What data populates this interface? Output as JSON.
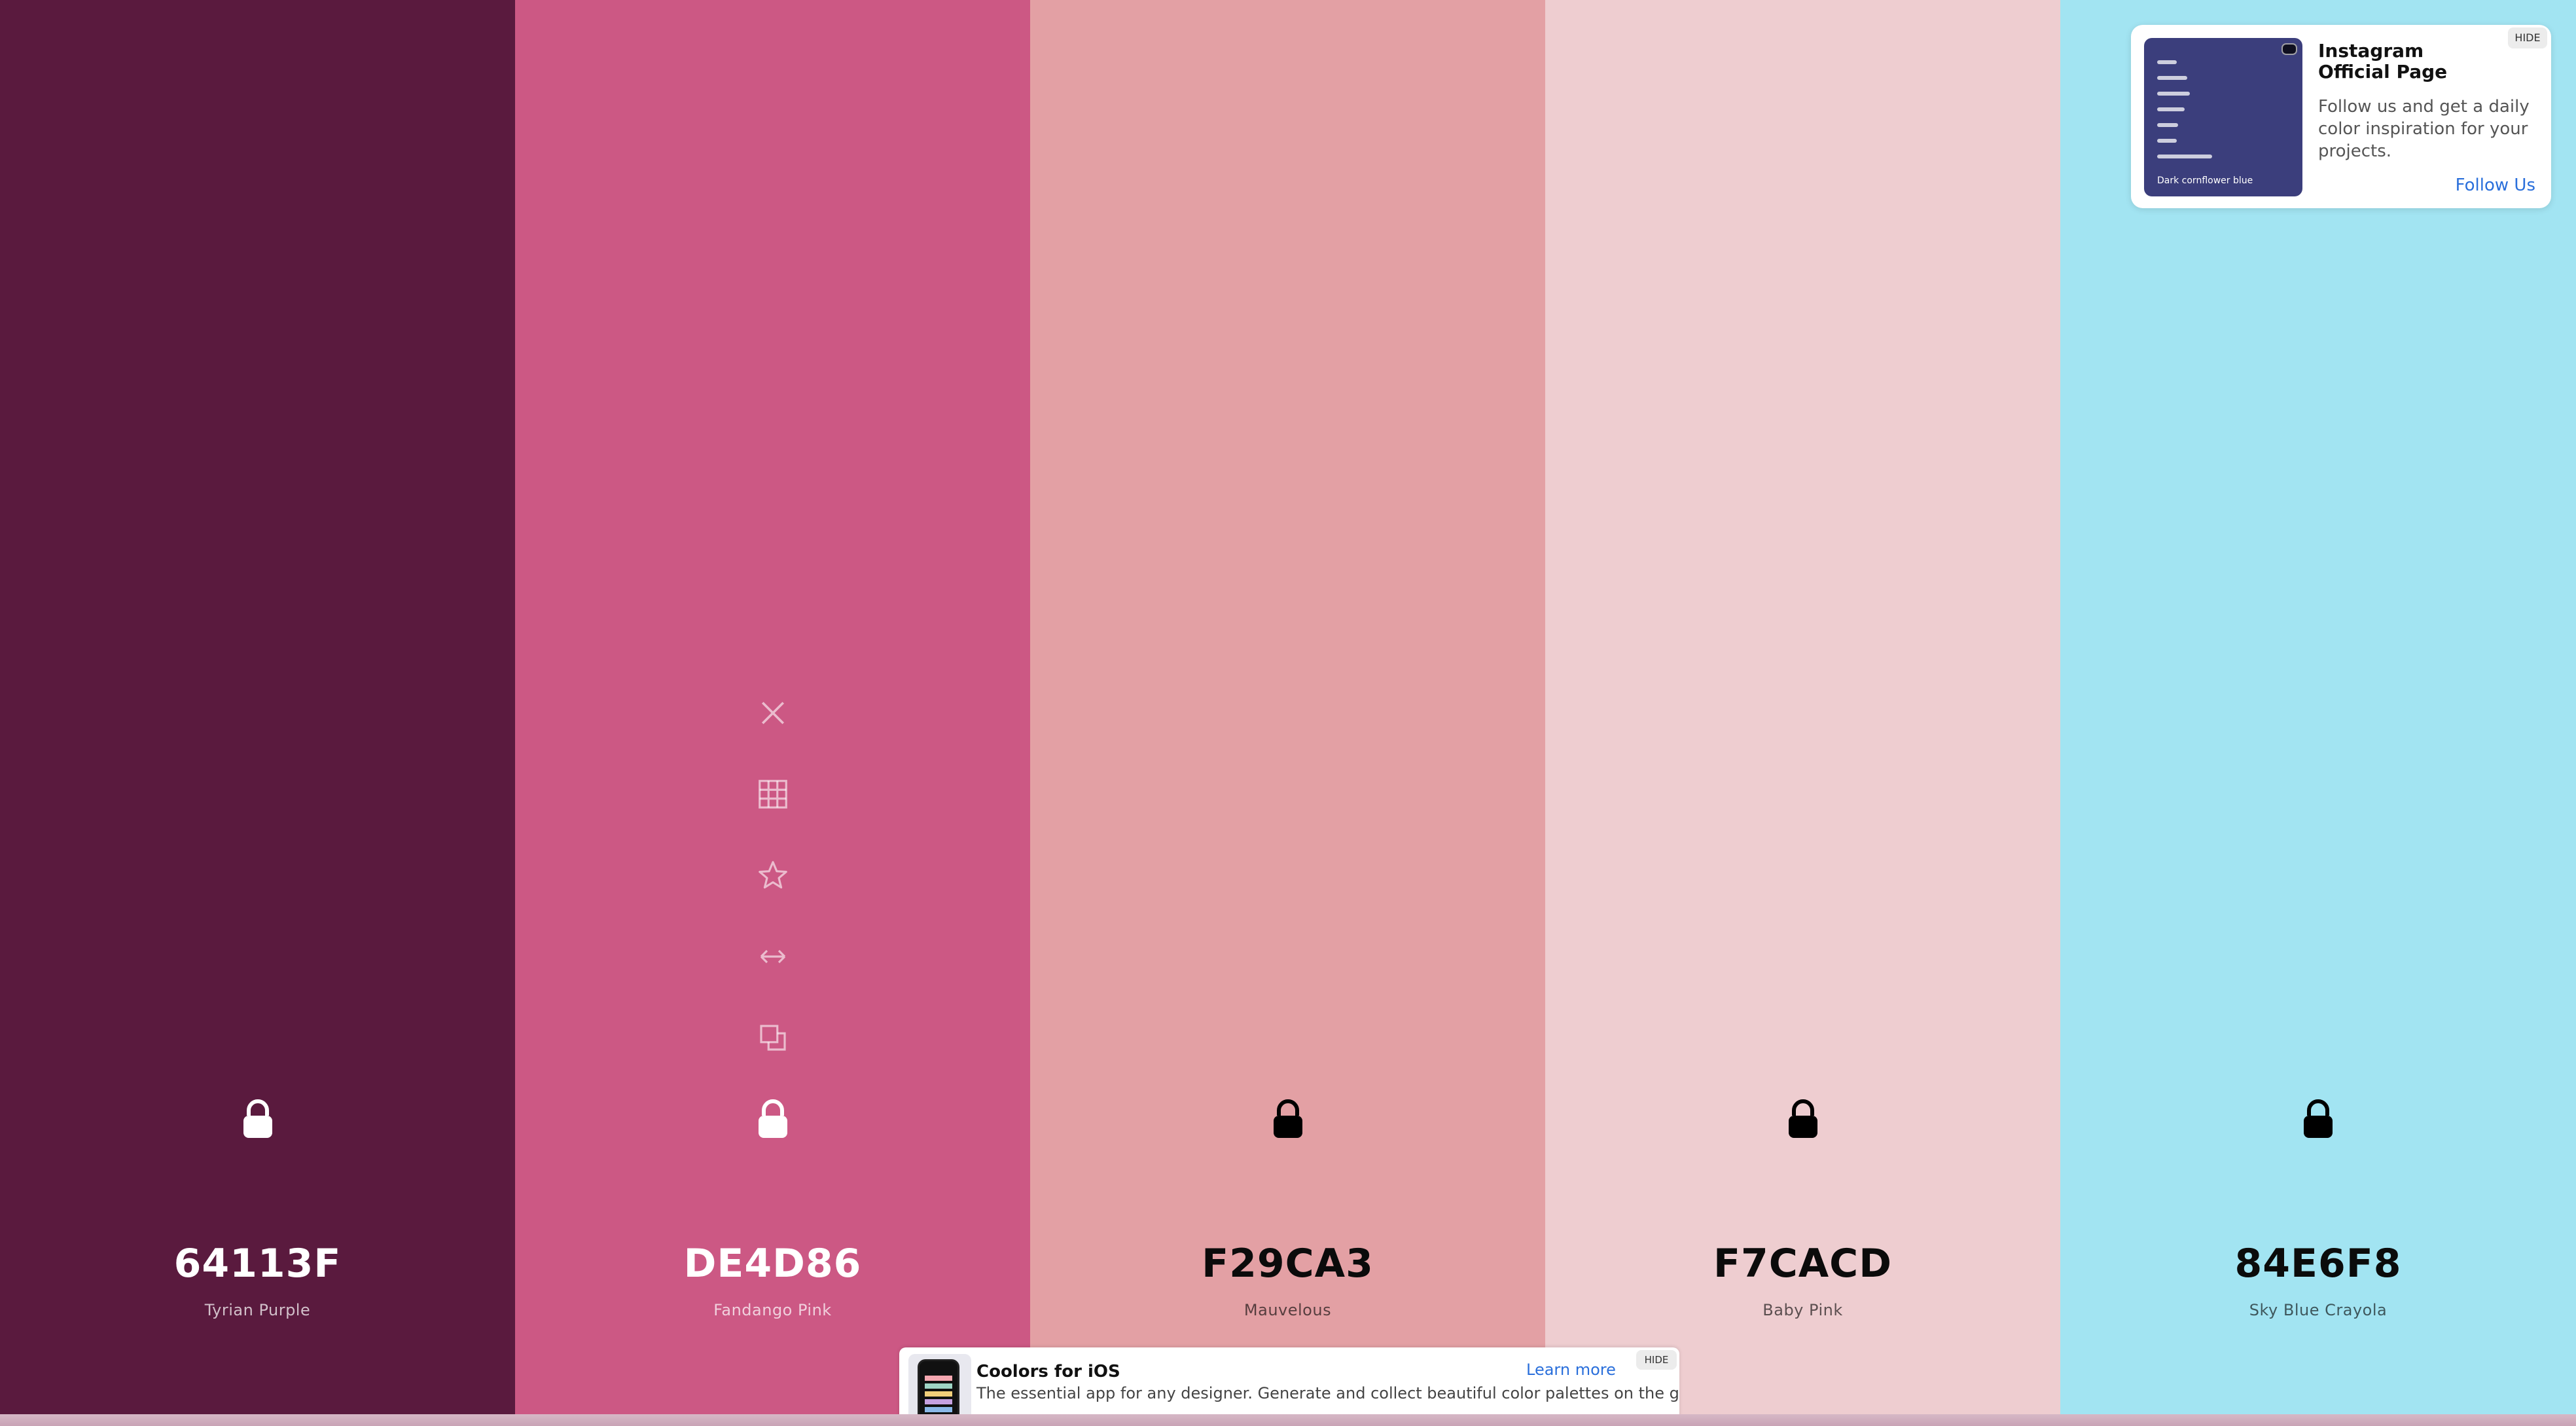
{
  "palette": [
    {
      "hex": "64113F",
      "name": "Tyrian Purple",
      "color": "#5a1a3e",
      "text_theme": "light"
    },
    {
      "hex": "DE4D86",
      "name": "Fandango Pink",
      "color": "#cc5884",
      "text_theme": "light"
    },
    {
      "hex": "F29CA3",
      "name": "Mauvelous",
      "color": "#e3a0a4",
      "text_theme": "dark"
    },
    {
      "hex": "F7CACD",
      "name": "Baby Pink",
      "color": "#eecdd0",
      "text_theme": "dark"
    },
    {
      "hex": "84E6F8",
      "name": "Sky Blue Crayola",
      "color": "#a2e4f2",
      "text_theme": "dark"
    }
  ],
  "column_tools": [
    "close-icon",
    "grid-icon",
    "star-icon",
    "resize-arrows-icon",
    "copy-icon"
  ],
  "instagram_card": {
    "hide_label": "HIDE",
    "title": "Instagram\nOfficial Page",
    "description": "Follow us and get a daily color inspiration for your projects.",
    "link_label": "Follow Us",
    "thumbnail_caption": "Dark cornflower blue",
    "thumbnail_color": "#3b3e7c"
  },
  "bottom_ad": {
    "title": "Coolors for iOS",
    "description": "The essential app for any designer. Generate and collect beautiful color palettes on the go.",
    "link_label": "Learn more",
    "hide_label": "HIDE"
  },
  "colors": {
    "link_blue": "#2a6fdb",
    "tool_icon": "rgba(255,255,255,0.55)"
  }
}
